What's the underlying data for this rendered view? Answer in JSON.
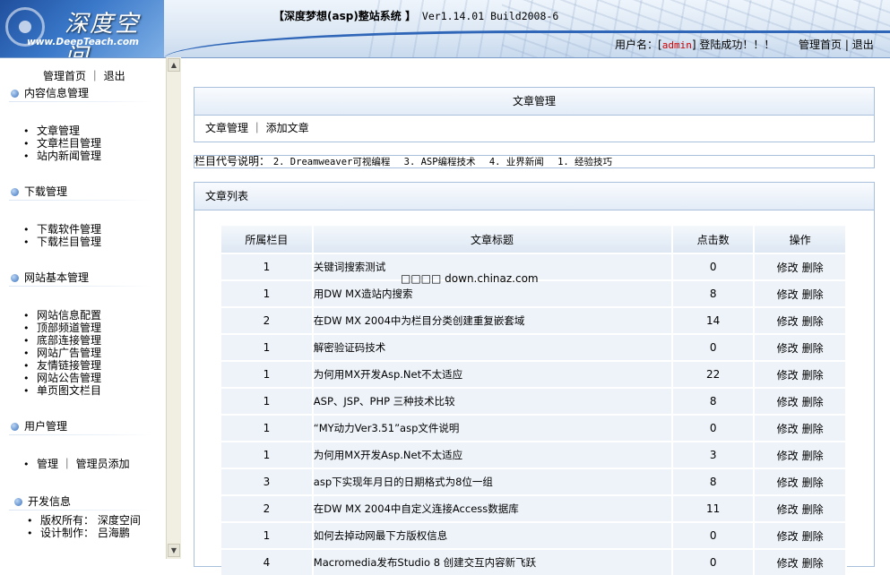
{
  "header": {
    "logo_title": "深度空间",
    "logo_url": "www.DeepTeach.com",
    "system_title": "【深度梦想(asp)整站系统 】",
    "version": "Ver1.14.01 Build2008-6",
    "user_label": "用户名：",
    "username": "admin",
    "login_success": "登陆成功！！！",
    "home_link": "管理首页",
    "logout_link": "退出"
  },
  "sidebar": {
    "top_home": "管理首页",
    "top_logout": "退出",
    "sections": [
      {
        "title": "内容信息管理",
        "items": [
          "文章管理",
          "文章栏目管理",
          "站内新闻管理"
        ]
      },
      {
        "title": "下载管理",
        "items": [
          "下载软件管理",
          "下载栏目管理"
        ]
      },
      {
        "title": "网站基本管理",
        "items": [
          "网站信息配置",
          "顶部频道管理",
          "底部连接管理",
          "网站广告管理",
          "友情链接管理",
          "网站公告管理",
          "单页图文栏目"
        ]
      },
      {
        "title": "用户管理",
        "items": [
          "管理 ｜ 管理员添加"
        ]
      },
      {
        "title": "开发信息",
        "items": [
          "版权所有： 深度空间",
          "设计制作： 吕海鹏"
        ]
      }
    ]
  },
  "article_panel": {
    "title": "文章管理",
    "link_manage": "文章管理",
    "link_add": "添加文章"
  },
  "category_bar": {
    "label": "栏目代号说明：",
    "items": [
      "2. Dreamweaver可视编程",
      "3. ASP编程技术",
      "4. 业界新闻",
      "1. 经验技巧"
    ]
  },
  "list_panel": {
    "title": "文章列表",
    "columns": [
      "所属栏目",
      "文章标题",
      "点击数",
      "操作"
    ],
    "edit_label": "修改",
    "delete_label": "删除",
    "rows": [
      {
        "cat": "1",
        "title": "关键词搜索测试",
        "hits": "0"
      },
      {
        "cat": "1",
        "title": "用DW MX造站内搜索",
        "hits": "8"
      },
      {
        "cat": "2",
        "title": "在DW MX 2004中为栏目分类创建重复嵌套域",
        "hits": "14"
      },
      {
        "cat": "1",
        "title": "解密验证码技术",
        "hits": "0"
      },
      {
        "cat": "1",
        "title": "为何用MX开发Asp.Net不太适应",
        "hits": "22"
      },
      {
        "cat": "1",
        "title": "ASP、JSP、PHP 三种技术比较",
        "hits": "8"
      },
      {
        "cat": "1",
        "title": "“MY动力Ver3.51”asp文件说明",
        "hits": "0"
      },
      {
        "cat": "1",
        "title": "为何用MX开发Asp.Net不太适应",
        "hits": "3"
      },
      {
        "cat": "3",
        "title": "asp下实现年月日的日期格式为8位一组",
        "hits": "8"
      },
      {
        "cat": "2",
        "title": "在DW MX 2004中自定义连接Access数据库",
        "hits": "11"
      },
      {
        "cat": "1",
        "title": "如何去掉动网最下方版权信息",
        "hits": "0"
      },
      {
        "cat": "4",
        "title": "Macromedia发布Studio 8 创建交互内容新飞跃",
        "hits": "0"
      }
    ]
  },
  "watermark": "□□□□ down.chinaz.com"
}
